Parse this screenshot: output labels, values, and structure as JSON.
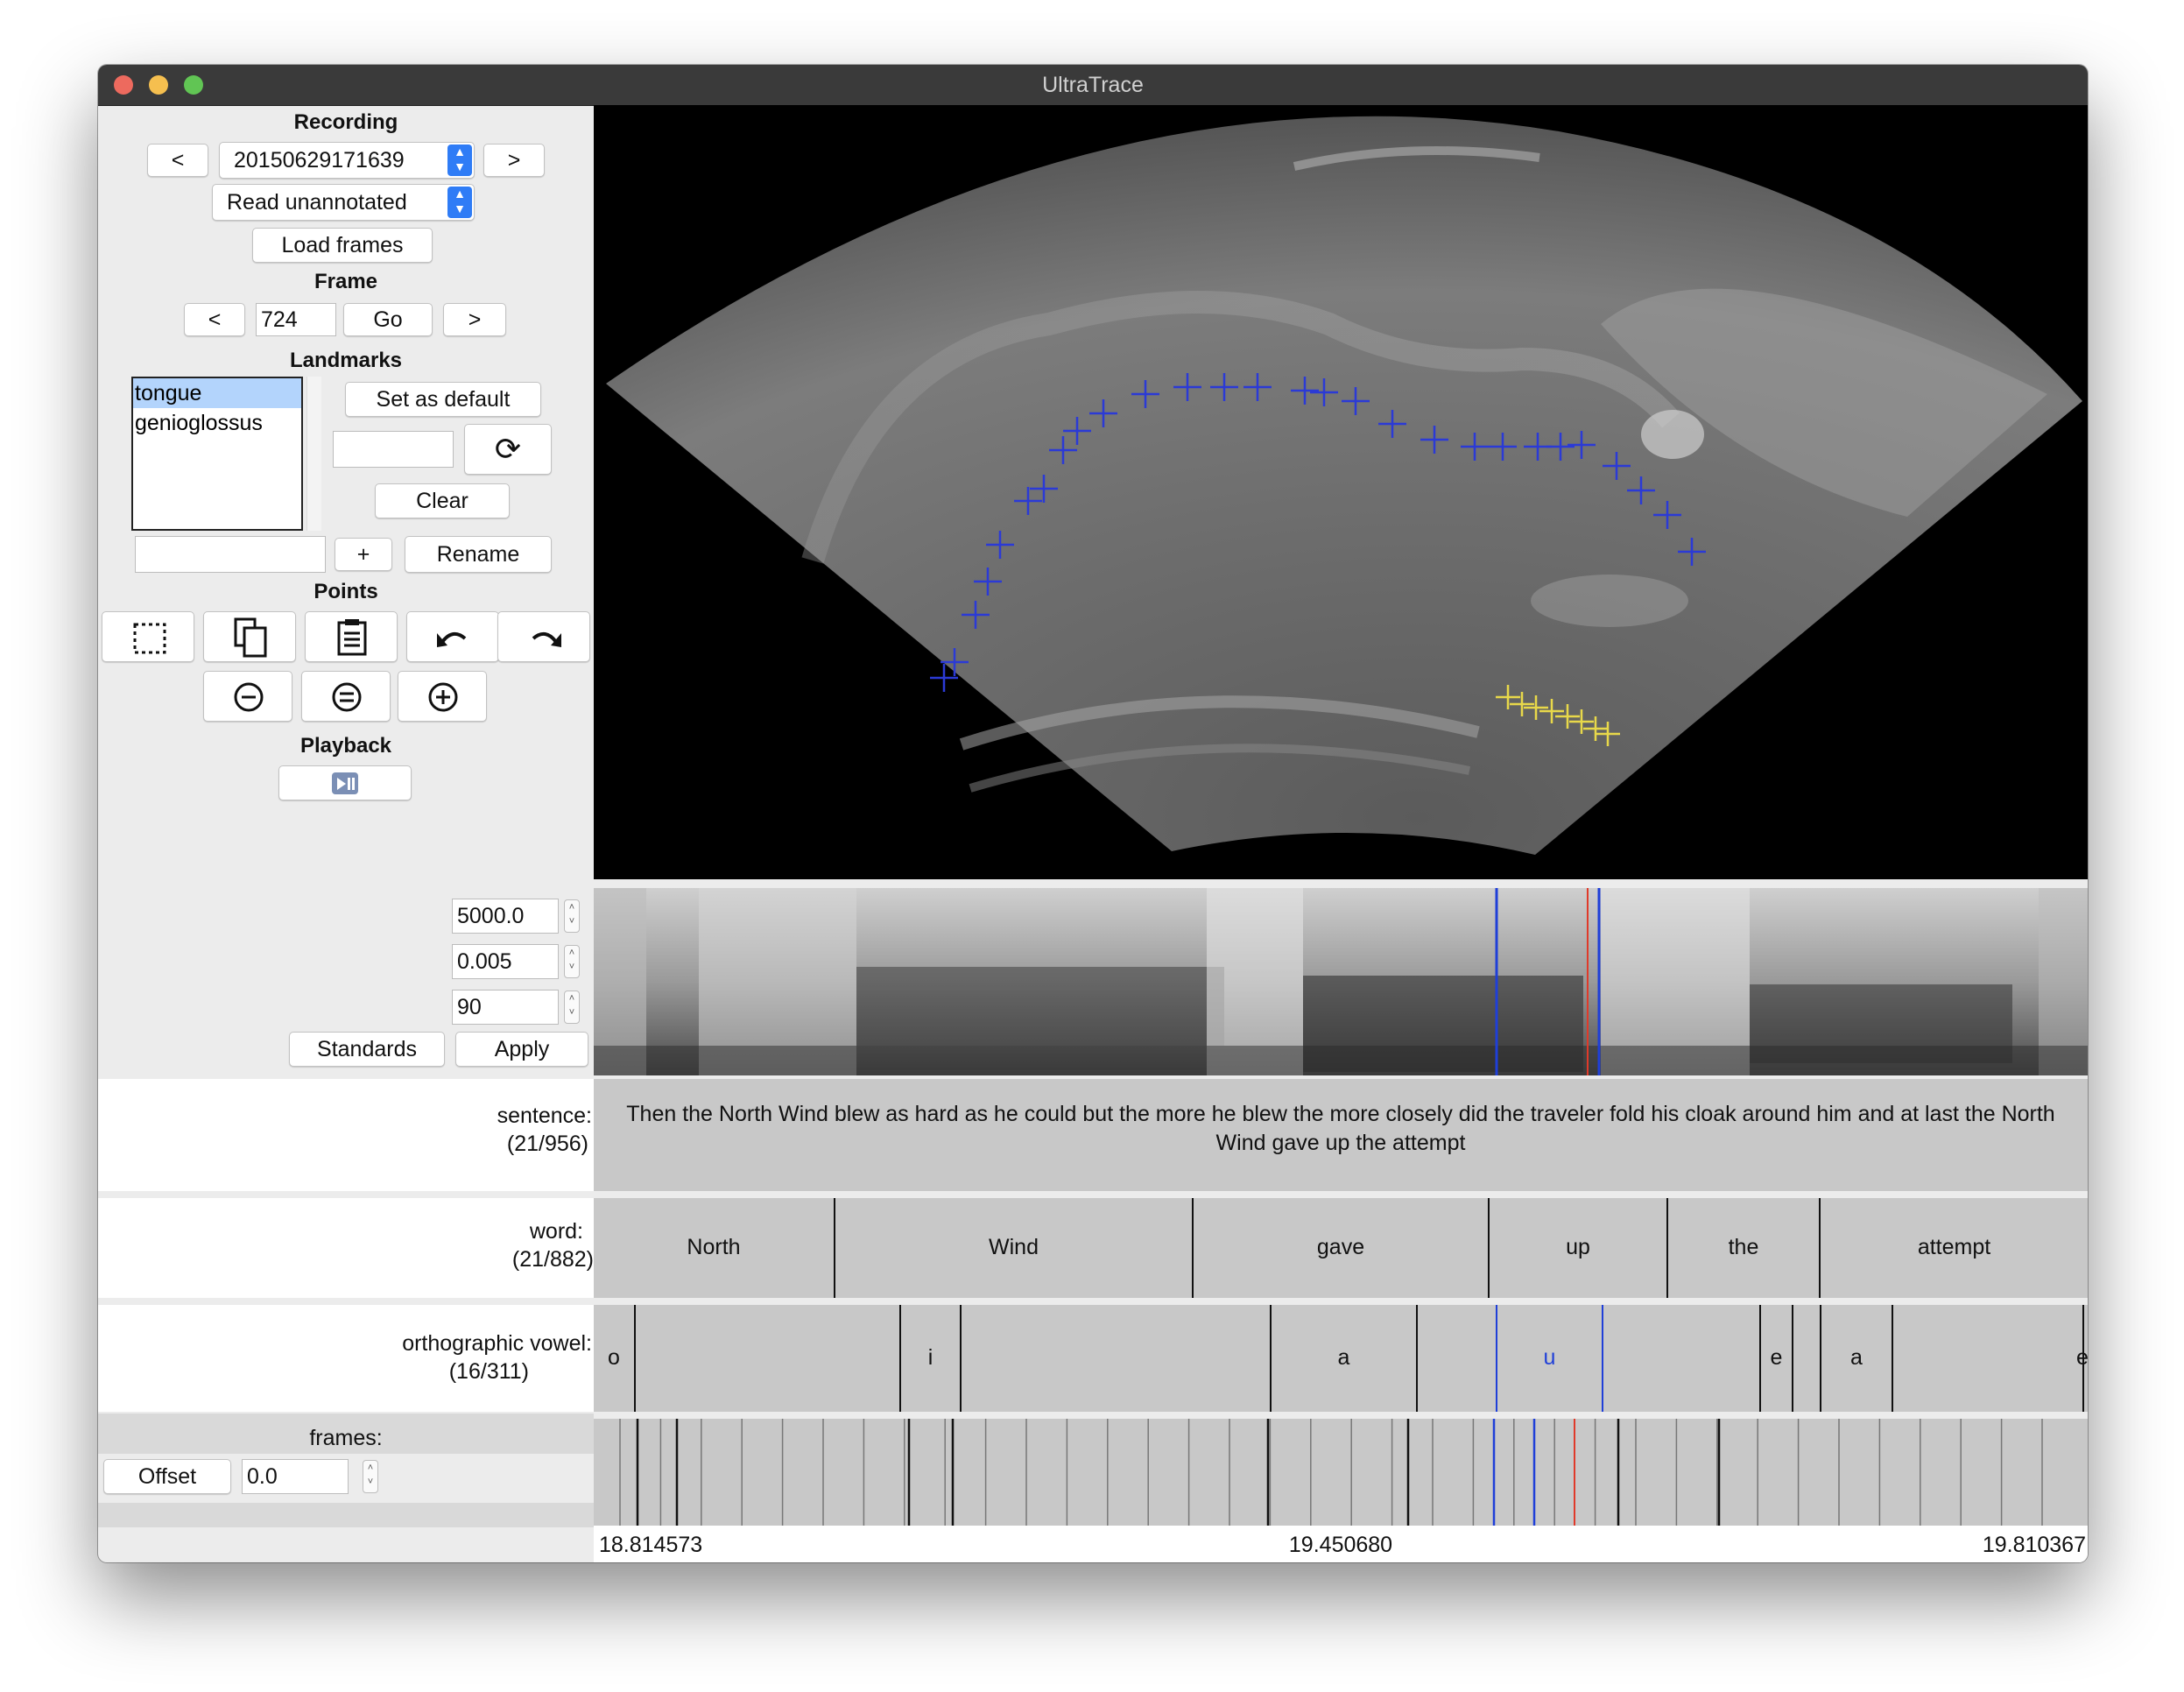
{
  "window": {
    "title": "UltraTrace",
    "traffic_lights": {
      "close": "#ed6a5e",
      "minimize": "#f5bf4f",
      "zoom": "#61c554"
    }
  },
  "recording": {
    "header": "Recording",
    "prev_label": "<",
    "next_label": ">",
    "selected": "20150629171639",
    "filter_selected": "Read unannotated",
    "load_frames_label": "Load frames"
  },
  "frame": {
    "header": "Frame",
    "prev_label": "<",
    "value": "724",
    "go_label": "Go",
    "next_label": ">"
  },
  "landmarks": {
    "header": "Landmarks",
    "items": [
      "tongue",
      "genioglossus"
    ],
    "selected_index": 0,
    "set_default_label": "Set as default",
    "color_value": "",
    "clear_label": "Clear",
    "new_name_value": "",
    "add_label": "+",
    "rename_label": "Rename",
    "refresh_icon": "refresh-icon"
  },
  "points": {
    "header": "Points",
    "tools": [
      "select-rect-icon",
      "copy-icon",
      "paste-icon",
      "undo-icon",
      "redo-icon",
      "zoom-out-icon",
      "zoom-reset-icon",
      "zoom-in-icon"
    ]
  },
  "playback": {
    "header": "Playback",
    "icon": "play-pause-icon"
  },
  "spectrogram": {
    "max_freq": "5000.0",
    "window_length": "0.005",
    "dynamic_range": "90",
    "standards_label": "Standards",
    "apply_label": "Apply"
  },
  "tiers": {
    "sentence": {
      "label": "sentence:",
      "count": "(21/956)",
      "text": "Then the North Wind blew as hard as he could but the more he blew the more closely did the traveler fold his cloak around him and at last the North Wind gave up the attempt"
    },
    "word": {
      "label": "word:",
      "count": "(21/882)",
      "segments": [
        "North",
        "Wind",
        "gave",
        "up",
        "the",
        "attempt"
      ]
    },
    "vowel": {
      "label": "orthographic vowel:",
      "count": "(16/311)",
      "segments": [
        "o",
        "i",
        "a",
        "u",
        "e",
        "a",
        "e"
      ],
      "selected": "u"
    },
    "frames": {
      "label": "frames:",
      "offset_label": "Offset",
      "offset_value": "0.0"
    }
  },
  "time_axis": {
    "start": "18.814573",
    "middle": "19.450680",
    "end": "19.810367"
  },
  "colors": {
    "tongue_trace": "#2b3ad6",
    "genioglossus_trace": "#e8d84a",
    "selection_line": "#1f3fd8",
    "cursor_line": "#e03a2a"
  }
}
